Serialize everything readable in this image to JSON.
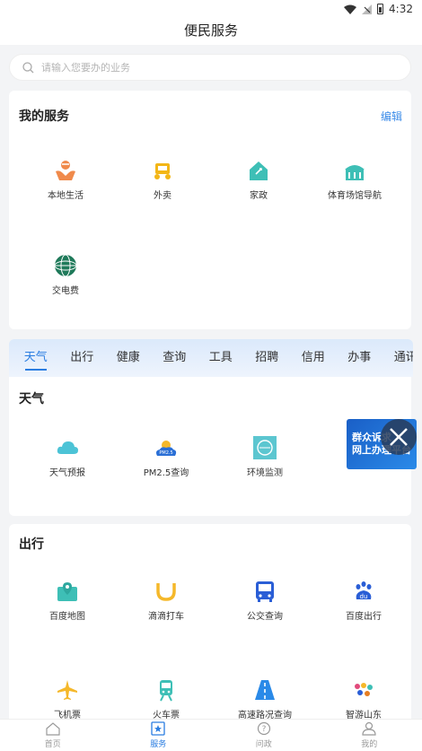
{
  "status_bar": {
    "time": "4:32"
  },
  "header": {
    "title": "便民服务"
  },
  "search": {
    "placeholder": "请输入您要办的业务"
  },
  "my_services": {
    "title": "我的服务",
    "edit_label": "编辑",
    "items": [
      {
        "label": "本地生活",
        "icon": "local-life-icon"
      },
      {
        "label": "外卖",
        "icon": "takeout-icon"
      },
      {
        "label": "家政",
        "icon": "housekeeping-icon"
      },
      {
        "label": "体育场馆导航",
        "icon": "stadium-icon"
      },
      {
        "label": "交电费",
        "icon": "electric-bill-icon"
      }
    ]
  },
  "tabs": [
    "天气",
    "出行",
    "健康",
    "查询",
    "工具",
    "招聘",
    "信用",
    "办事",
    "通讯"
  ],
  "weather": {
    "title": "天气",
    "items": [
      {
        "label": "天气预报",
        "icon": "cloud-icon"
      },
      {
        "label": "PM2.5查询",
        "icon": "pm25-icon"
      },
      {
        "label": "环境监测",
        "icon": "environment-icon"
      }
    ]
  },
  "banner": {
    "line1": "群众诉求",
    "line2": "网上办理平台"
  },
  "travel": {
    "title": "出行",
    "items": [
      {
        "label": "百度地图",
        "icon": "map-icon"
      },
      {
        "label": "滴滴打车",
        "icon": "didi-icon"
      },
      {
        "label": "公交查询",
        "icon": "bus-icon"
      },
      {
        "label": "百度出行",
        "icon": "baidu-icon"
      },
      {
        "label": "飞机票",
        "icon": "plane-icon"
      },
      {
        "label": "火车票",
        "icon": "train-icon"
      },
      {
        "label": "高速路况查询",
        "icon": "highway-icon"
      },
      {
        "label": "智游山东",
        "icon": "shandong-tour-icon"
      }
    ]
  },
  "tabbar": [
    {
      "label": "首页",
      "icon": "home-icon",
      "active": false
    },
    {
      "label": "服务",
      "icon": "service-icon",
      "active": true
    },
    {
      "label": "问政",
      "icon": "question-icon",
      "active": false
    },
    {
      "label": "我的",
      "icon": "user-icon",
      "active": false
    }
  ],
  "colors": {
    "accent": "#2a7de1",
    "link": "#3a8be8",
    "background": "#f3f4f6"
  }
}
